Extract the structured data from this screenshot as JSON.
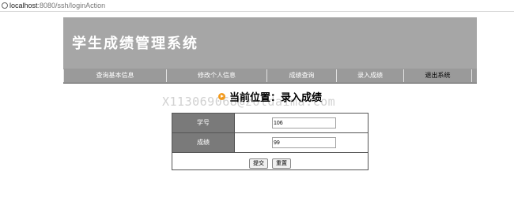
{
  "browser": {
    "url_host": "localhost",
    "url_rest": ":8080/ssh/loginAction"
  },
  "header": {
    "title": "学生成绩管理系统"
  },
  "nav": {
    "items": [
      {
        "label": "查询基本信息"
      },
      {
        "label": "修改个人信息"
      },
      {
        "label": "成绩查询"
      },
      {
        "label": "录入成绩"
      },
      {
        "label": "退出系统"
      }
    ]
  },
  "page": {
    "heading": "当前位置：录入成绩"
  },
  "watermark": {
    "text": "X113069068@zoldaima.com"
  },
  "form": {
    "student_id_label": "学号",
    "student_id_value": "106",
    "score_label": "成绩",
    "score_value": "99",
    "submit_label": "提交",
    "reset_label": "重置"
  },
  "colors": {
    "banner": "#a6a6a6",
    "nav": "#9a9a9a",
    "label_cell": "#7a7a7a",
    "heading_icon": "#f29a1d"
  }
}
